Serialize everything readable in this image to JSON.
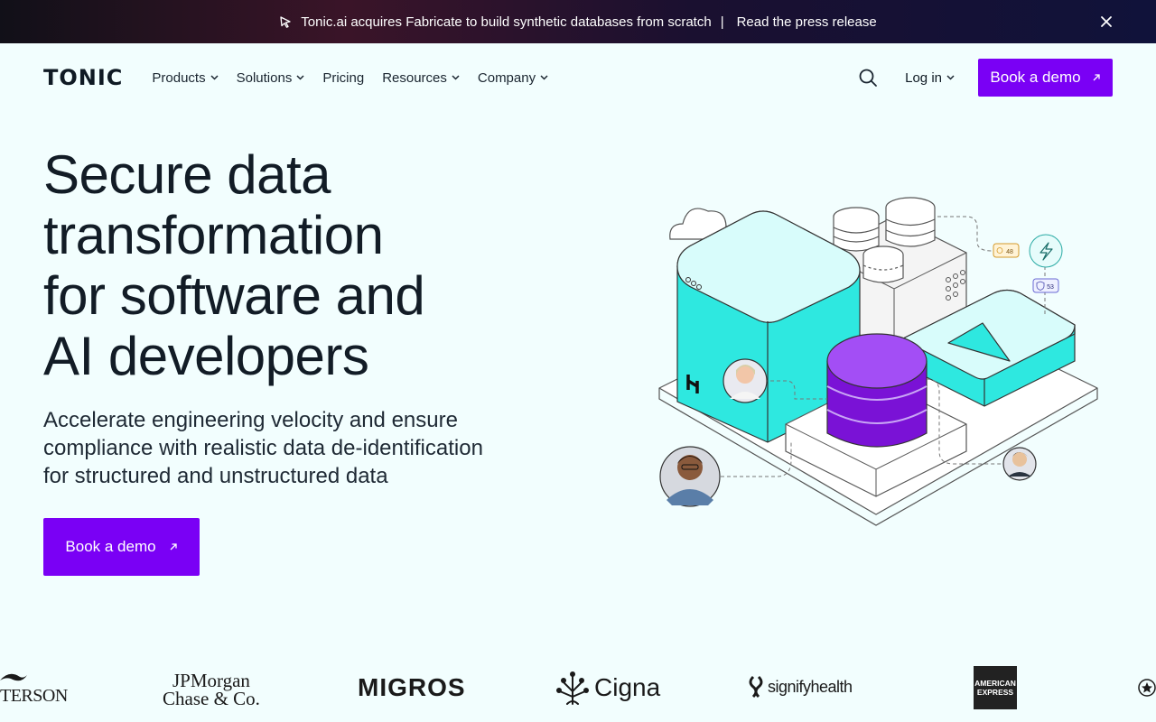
{
  "announcement": {
    "message": "Tonic.ai acquires Fabricate to build synthetic databases from scratch",
    "separator": "|",
    "link_text": "Read the press release"
  },
  "nav": {
    "logo": "TONIC",
    "items": [
      {
        "label": "Products",
        "has_dropdown": true
      },
      {
        "label": "Solutions",
        "has_dropdown": true
      },
      {
        "label": "Pricing",
        "has_dropdown": false
      },
      {
        "label": "Resources",
        "has_dropdown": true
      },
      {
        "label": "Company",
        "has_dropdown": true
      }
    ],
    "login_label": "Log in",
    "cta_label": "Book a demo"
  },
  "hero": {
    "title_lines": [
      "Secure data",
      "transformation",
      "for software and",
      "AI developers"
    ],
    "subtitle_lines": [
      "Accelerate engineering velocity and ensure",
      "compliance with realistic data de-identification",
      "for structured and unstructured data"
    ],
    "cta_label": "Book a demo"
  },
  "illustration": {
    "badge_1": "48",
    "badge_2": "53"
  },
  "logos": {
    "paterson": "TERSON",
    "jpm_line1": "JPMorgan",
    "jpm_line2": "Chase & Co.",
    "migros": "MIGROS",
    "cigna": "Cigna",
    "signify": "signifyhealth",
    "amex_line1": "AMERICAN",
    "amex_line2": "EXPRESS"
  },
  "colors": {
    "accent": "#7a00f5",
    "background": "#f2fefe",
    "cyan": "#2ee8e0",
    "purple": "#8a2be2"
  }
}
